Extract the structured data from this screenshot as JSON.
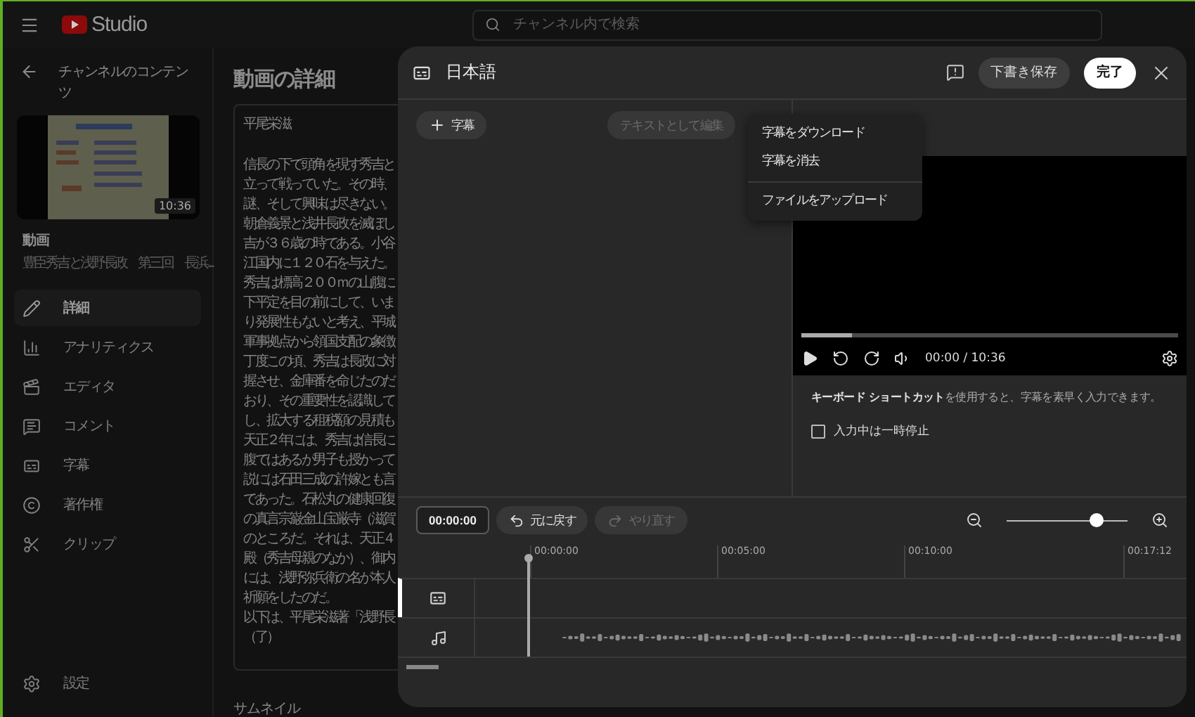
{
  "topbar": {
    "brand": "Studio",
    "search": {
      "placeholder": "チャンネル内で検索"
    }
  },
  "sidebar": {
    "back_label": "チャンネルのコンテンツ",
    "video": {
      "duration": "10:36",
      "heading": "動画",
      "title": "豊臣秀吉と浅野長政　第三回　長浜..."
    },
    "items": [
      {
        "label": "詳細",
        "selected": true
      },
      {
        "label": "アナリティクス",
        "selected": false
      },
      {
        "label": "エディタ",
        "selected": false
      },
      {
        "label": "コメント",
        "selected": false
      },
      {
        "label": "字幕",
        "selected": false
      },
      {
        "label": "著作権",
        "selected": false
      },
      {
        "label": "クリップ",
        "selected": false
      }
    ],
    "settings": "設定"
  },
  "main": {
    "title": "動画の詳細",
    "description": {
      "author": "平尾栄滋",
      "lines": [
        "信長の下で頭角を現す秀吉と",
        "立って戦っていた。その時、",
        "謎、そして興味は尽きない。",
        "朝倉義景と浅井長政を滅ぼし",
        "吉が３６歳の時である。小谷",
        "江国内に１２０石を与えた。",
        "秀吉は標高２００ｍの山腹に",
        "下平定を目の前にして、いま",
        "り発展性もないと考え、平城",
        "軍事拠点から領国支配の象徴",
        "丁度この頃、秀吉は長政に対",
        "握させ、金庫番を命じたのだ",
        "おり、その重要性を認識して",
        "し、拡大する租税額の見積も",
        "天正２年には、秀吉は信長に",
        "腹ではあるが男子も授かって",
        "説には石田三成の許嫁とも言",
        "であった。石松丸の健康回復",
        "の真言宗巌金山宝厳寺（滋賀",
        "のところだ。それは、天正４",
        "殿（秀吉母親のなか）、御内",
        "には、浅野弥兵衛の名が本人",
        "祈願をしたのだ。",
        "以下は、平尾栄滋著「浅野長",
        "（了）"
      ]
    },
    "thumbnail_heading": "サムネイル"
  },
  "dialog": {
    "title": "日本語",
    "draft_button": "下書き保存",
    "done_button": "完了",
    "add_caption_button": "字幕",
    "edit_as_text_button": {
      "label": "テキストとして編集",
      "disabled": true
    },
    "menu": [
      [
        "字幕をダウンロード",
        "字幕を消去"
      ],
      [
        "ファイルをアップロード"
      ]
    ],
    "player": {
      "progress": {
        "level": 0.135
      },
      "time": "00:00 / 10:36"
    },
    "shortcut_text": "**キーボード ショートカット**を使用すると、字幕を素早く入力できます。",
    "pause_while_typing": {
      "label": "入力中は一時停止",
      "checked": false
    },
    "toolbar": {
      "time": "00:00:00",
      "undo": {
        "label": "元に戻す",
        "disabled": false
      },
      "redo": {
        "label": "やり直す",
        "disabled": true
      },
      "zoom": {
        "level": 0.74
      }
    },
    "ruler": [
      "00:00:00",
      "00:05:00",
      "00:10:00",
      "00:17:12"
    ],
    "tracks": [
      {
        "kind": "subtitles",
        "selected": true
      },
      {
        "kind": "audio",
        "selected": false
      }
    ]
  }
}
